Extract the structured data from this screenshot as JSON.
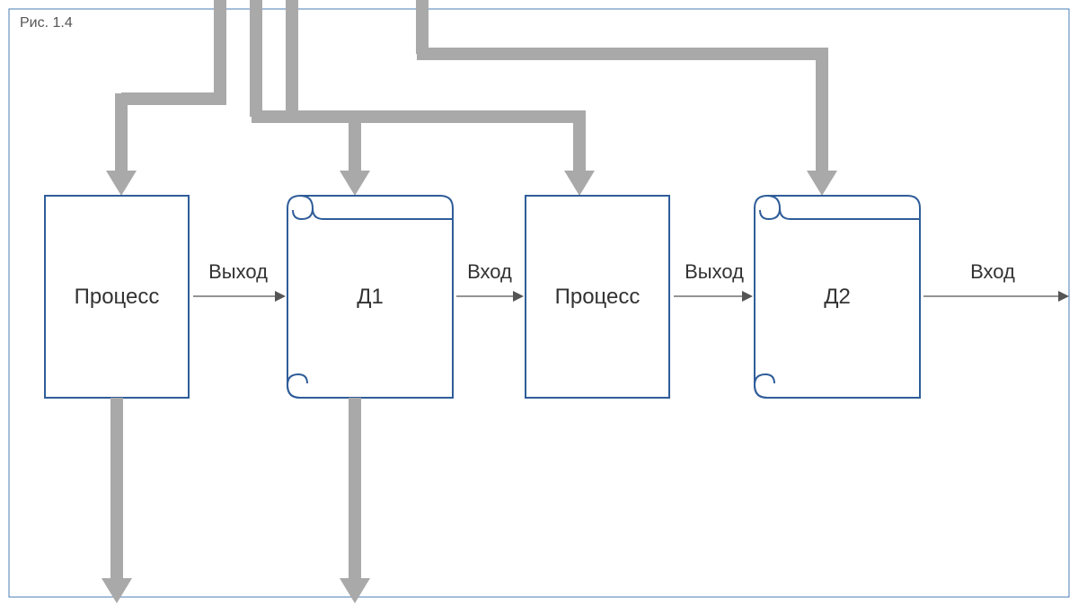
{
  "diagram": {
    "caption": "Рис. 1.4",
    "colors": {
      "frame_border": "#4a7db5",
      "node_stroke": "#2f5d99",
      "pipe_gray": "#a9a9a9",
      "thin_arrow": "#555555",
      "text": "#333333"
    },
    "nodes": [
      {
        "id": "p1",
        "kind": "process",
        "label": "Процесс"
      },
      {
        "id": "d1",
        "kind": "document",
        "label": "Д1"
      },
      {
        "id": "p2",
        "kind": "process",
        "label": "Процесс"
      },
      {
        "id": "d2",
        "kind": "document",
        "label": "Д2"
      }
    ],
    "horizontal_edges": [
      {
        "from": "p1",
        "to": "d1",
        "label": "Выход"
      },
      {
        "from": "d1",
        "to": "p2",
        "label": "Вход"
      },
      {
        "from": "p2",
        "to": "d2",
        "label": "Выход"
      },
      {
        "from": "d2",
        "to": "out",
        "label": "Вход"
      }
    ],
    "inflow_pipes": [
      {
        "enters_from_top_at": "above_p1_right",
        "branches": [
          "down_to_p1",
          "merge_right_at_d1"
        ]
      },
      {
        "enters_from_top_at": "above_d1",
        "branches": [
          "down_to_d1",
          "right_to_p2"
        ]
      },
      {
        "enters_from_top_at": "above_p2_offset",
        "branches": [
          "right_to_d2",
          "merge_into_p2_via_bus"
        ]
      }
    ],
    "outflow_pipes": [
      {
        "from": "p1",
        "direction": "down"
      },
      {
        "from": "d1",
        "direction": "down"
      }
    ]
  }
}
